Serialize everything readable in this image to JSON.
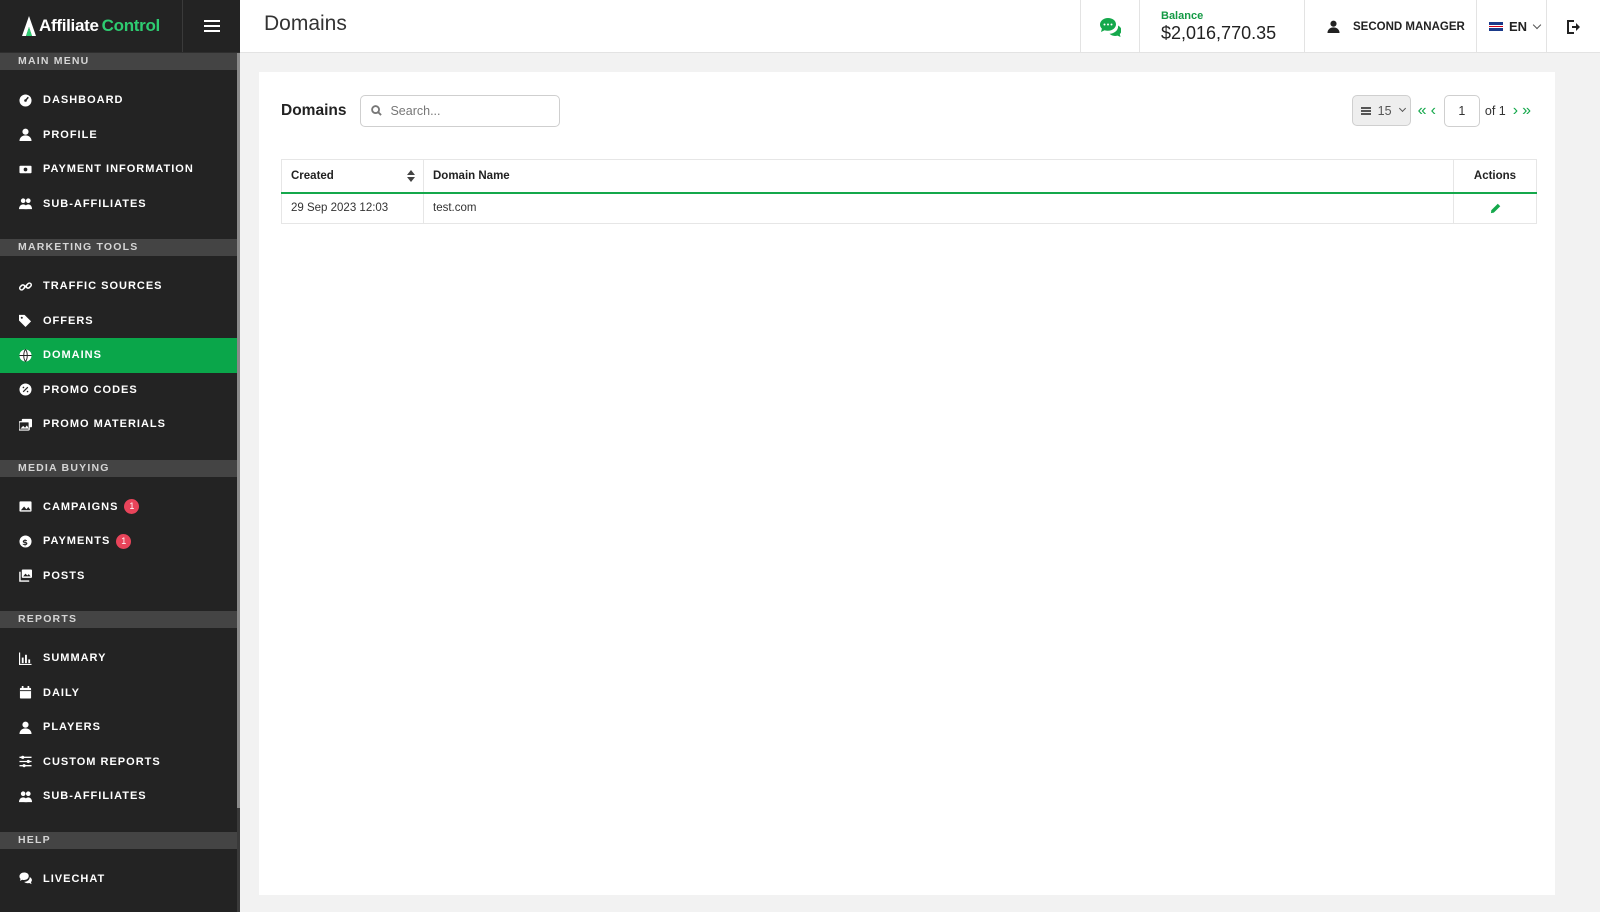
{
  "brand": {
    "name_part1": "Affiliate",
    "name_part2": "Control"
  },
  "sidebar": {
    "sections": [
      {
        "title": "MAIN MENU",
        "items": [
          {
            "label": "DASHBOARD",
            "icon": "dashboard-icon"
          },
          {
            "label": "PROFILE",
            "icon": "user-icon"
          },
          {
            "label": "PAYMENT INFORMATION",
            "icon": "money-icon"
          },
          {
            "label": "SUB-AFFILIATES",
            "icon": "users-icon"
          }
        ]
      },
      {
        "title": "MARKETING TOOLS",
        "items": [
          {
            "label": "TRAFFIC SOURCES",
            "icon": "link-icon"
          },
          {
            "label": "OFFERS",
            "icon": "tags-icon"
          },
          {
            "label": "DOMAINS",
            "icon": "globe-icon",
            "active": true
          },
          {
            "label": "PROMO CODES",
            "icon": "badge-percent-icon"
          },
          {
            "label": "PROMO MATERIALS",
            "icon": "images-icon"
          }
        ]
      },
      {
        "title": "MEDIA BUYING",
        "items": [
          {
            "label": "CAMPAIGNS",
            "icon": "image-icon",
            "badge": "1"
          },
          {
            "label": "PAYMENTS",
            "icon": "dollar-circle-icon",
            "badge": "1"
          },
          {
            "label": "POSTS",
            "icon": "photo-stack-icon"
          }
        ]
      },
      {
        "title": "REPORTS",
        "items": [
          {
            "label": "SUMMARY",
            "icon": "bar-chart-icon"
          },
          {
            "label": "DAILY",
            "icon": "calendar-icon"
          },
          {
            "label": "PLAYERS",
            "icon": "user-icon"
          },
          {
            "label": "CUSTOM REPORTS",
            "icon": "sliders-icon"
          },
          {
            "label": "SUB-AFFILIATES",
            "icon": "users-icon"
          }
        ]
      },
      {
        "title": "HELP",
        "items": [
          {
            "label": "LIVECHAT",
            "icon": "comments-icon"
          }
        ]
      }
    ]
  },
  "topbar": {
    "title": "Domains",
    "balance_label": "Balance",
    "balance_value": "$2,016,770.35",
    "user_name": "SECOND MANAGER",
    "language": "EN"
  },
  "main": {
    "card_title": "Domains",
    "search_placeholder": "Search...",
    "per_page": "15",
    "current_page": "1",
    "of_total": "of 1",
    "columns": {
      "created": "Created",
      "domain_name": "Domain Name",
      "actions": "Actions"
    },
    "rows": [
      {
        "created": "29 Sep 2023 12:03",
        "domain_name": "test.com"
      }
    ]
  },
  "colors": {
    "accent": "#0aa64a",
    "sidebar_bg": "#232323",
    "badge": "#e8445a"
  }
}
